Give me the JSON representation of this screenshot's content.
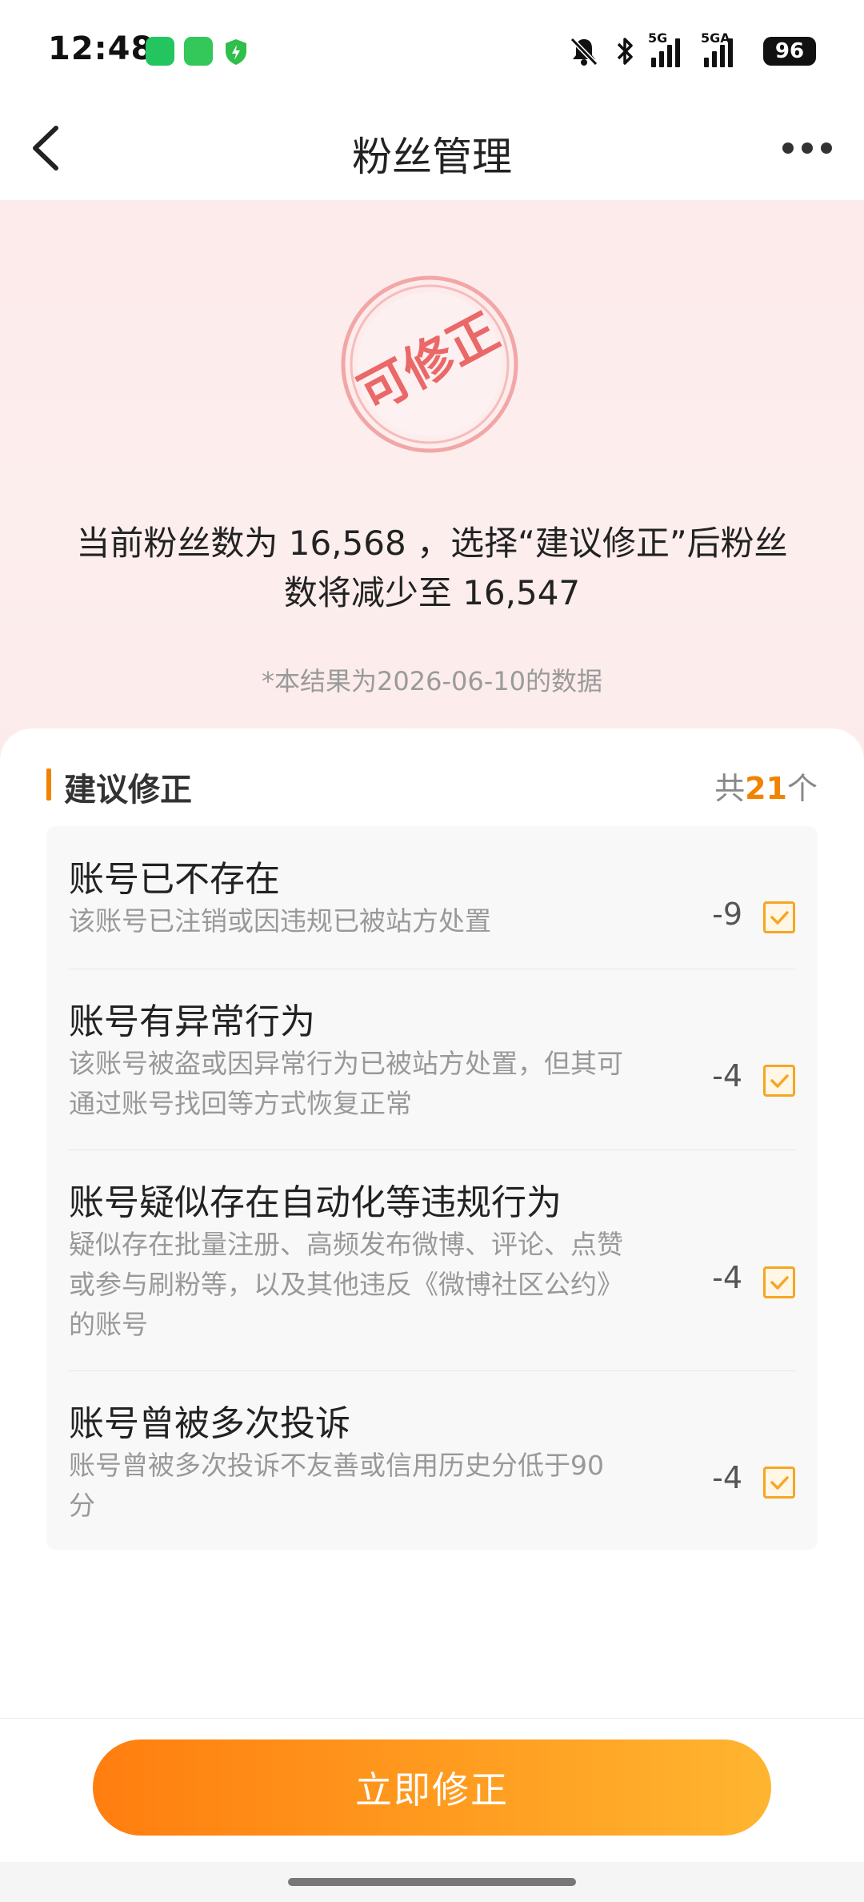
{
  "status_bar": {
    "time": "12:48",
    "signal_1_label": "5G",
    "signal_2_label": "5GA",
    "battery": "96"
  },
  "nav": {
    "title": "粉丝管理"
  },
  "stamp": {
    "text": "可修正",
    "color": "#e85a5a"
  },
  "summary": {
    "line1": "当前粉丝数为 16,568 ，选择“建议修正”后粉丝",
    "line2": "数将减少至 16,547",
    "note": "*本结果为2026-06-10的数据"
  },
  "section": {
    "title": "建议修正",
    "count_prefix": "共",
    "count": "21",
    "count_suffix": "个"
  },
  "items": [
    {
      "title": "账号已不存在",
      "desc": "该账号已注销或因违规已被站方处置",
      "value": "-9",
      "checked": true
    },
    {
      "title": "账号有异常行为",
      "desc": "该账号被盗或因异常行为已被站方处置，但其可通过账号找回等方式恢复正常",
      "value": "-4",
      "checked": true
    },
    {
      "title": "账号疑似存在自动化等违规行为",
      "desc": "疑似存在批量注册、高频发布微博、评论、点赞或参与刷粉等，以及其他违反《微博社区公约》的账号",
      "value": "-4",
      "checked": true
    },
    {
      "title": "账号曾被多次投诉",
      "desc": "账号曾被多次投诉不友善或信用历史分低于90分",
      "value": "-4",
      "checked": true
    }
  ],
  "action": {
    "button_label": "立即修正"
  },
  "colors": {
    "accent": "#f08300",
    "checkbox": "#f5a623",
    "button_start": "#ff7e0f",
    "button_end": "#ffb530"
  }
}
